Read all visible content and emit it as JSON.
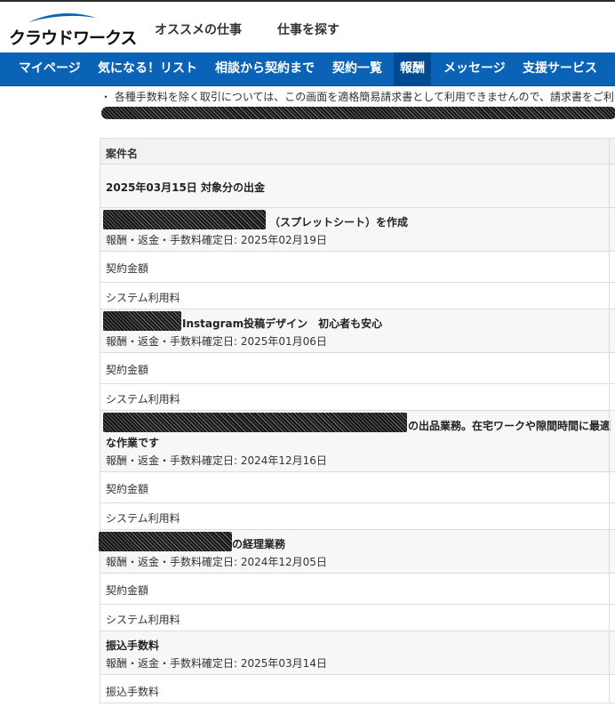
{
  "brand": {
    "logo_text": "クラウドワークス",
    "accent": "#0a63b6"
  },
  "header": {
    "links": [
      "オススメの仕事",
      "仕事を探す"
    ]
  },
  "nav": {
    "items": [
      "マイページ",
      "気になる！リスト",
      "相談から契約まで",
      "契約一覧",
      "報酬",
      "メッセージ",
      "支援サービス"
    ],
    "active": "報酬"
  },
  "note": "・ 各種手数料を除く取引については、この画面を適格簡易請求書として利用できませんので、請求書をご利",
  "table": {
    "header": "案件名",
    "group_title": "2025年03月15日 対象分の出金",
    "projects": [
      {
        "title_visible": "（スプレットシート）を作成",
        "date": "報酬・返金・手数料確定日: 2025年02月19日",
        "lines": [
          "契約金額",
          "システム利用料"
        ]
      },
      {
        "title_visible": "Instagram投稿デザイン　初心者も安心",
        "date": "報酬・返金・手数料確定日: 2025年01月06日",
        "lines": [
          "契約金額",
          "システム利用料"
        ]
      },
      {
        "title_visible": "の出品業務。在宅ワークや隙間時間に最適",
        "title_line2": "な作業です",
        "date": "報酬・返金・手数料確定日: 2024年12月16日",
        "lines": [
          "契約金額",
          "システム利用料"
        ]
      },
      {
        "title_visible": "の経理業務",
        "date": "報酬・返金・手数料確定日: 2024年12月05日",
        "lines": [
          "契約金額",
          "システム利用料"
        ]
      }
    ],
    "transfer": {
      "title": "振込手数料",
      "date": "報酬・返金・手数料確定日: 2025年03月14日",
      "line": "振込手数料"
    }
  }
}
